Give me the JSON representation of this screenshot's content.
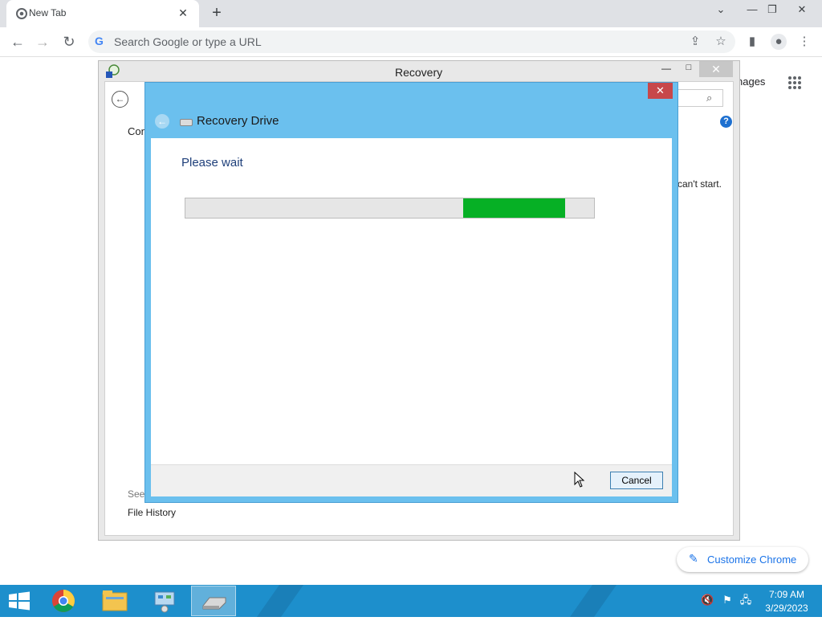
{
  "browser": {
    "tab_title": "New Tab",
    "tab_close": "✕",
    "new_tab": "+",
    "omnibox_placeholder": "Search Google or type a URL",
    "google_g": "G",
    "window_controls": {
      "dropdown": "⌄",
      "minimize": "—",
      "restore": "❐",
      "close": "✕"
    },
    "nav": {
      "back": "←",
      "forward": "→",
      "reload": "↻"
    },
    "toolbar_icons": {
      "share": "⇪",
      "bookmark": "☆",
      "side_panel": "▮",
      "profile": "●",
      "menu": "⋮"
    }
  },
  "ntp": {
    "images_link": "nages",
    "customize_label": "Customize Chrome",
    "customize_icon": "✎"
  },
  "recovery_window": {
    "title": "Recovery",
    "back": "←",
    "search_icon": "⌕",
    "help": "?",
    "con_text": "Con",
    "cant_start_text": "can't start.",
    "see_text": "See",
    "file_history_link": "File History",
    "minimize": "—",
    "maximize": "□",
    "close": "✕"
  },
  "wizard": {
    "title": "Recovery Drive",
    "close": "✕",
    "back": "←",
    "heading": "Please wait",
    "progress": {
      "indeterminate": true,
      "segment_start": 0.68,
      "segment_end": 0.93,
      "color": "#06b025"
    },
    "cancel_label": "Cancel"
  },
  "taskbar": {
    "time": "7:09 AM",
    "date": "3/29/2023",
    "items": [
      "chrome-app",
      "file-explorer-app",
      "control-panel-app",
      "recovery-drive-app"
    ],
    "tray": {
      "volume_muted": "🔇",
      "flag": "⚑",
      "network": "🖧"
    }
  },
  "colors": {
    "wizard_frame": "#6bc0ee",
    "progress_fill": "#06b025",
    "taskbar": "#1d8fcc",
    "close_red": "#c7474a"
  }
}
